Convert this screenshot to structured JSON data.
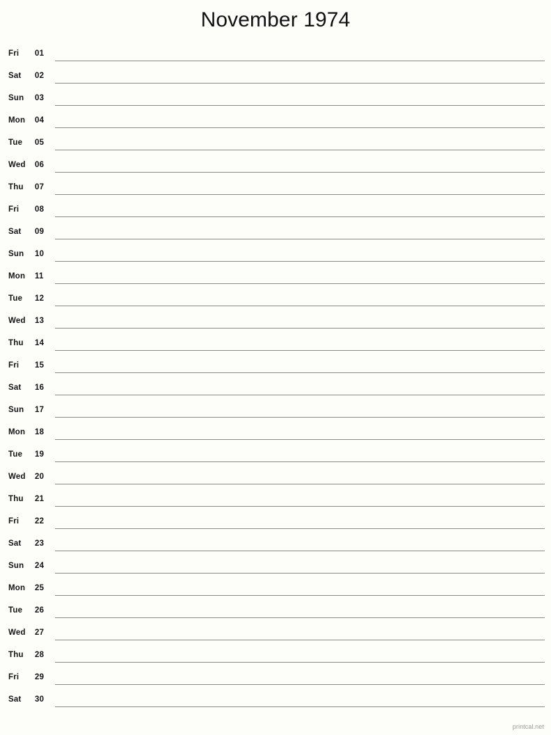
{
  "document": {
    "title": "November 1974",
    "month": "November",
    "year": "1974"
  },
  "footer": {
    "brand": "printcal.net"
  },
  "calendar": {
    "type": "single-column-notes-list",
    "days_in_month": 30,
    "first_weekday": "Fri",
    "rows": [
      {
        "weekday": "Fri",
        "date": "01"
      },
      {
        "weekday": "Sat",
        "date": "02"
      },
      {
        "weekday": "Sun",
        "date": "03"
      },
      {
        "weekday": "Mon",
        "date": "04"
      },
      {
        "weekday": "Tue",
        "date": "05"
      },
      {
        "weekday": "Wed",
        "date": "06"
      },
      {
        "weekday": "Thu",
        "date": "07"
      },
      {
        "weekday": "Fri",
        "date": "08"
      },
      {
        "weekday": "Sat",
        "date": "09"
      },
      {
        "weekday": "Sun",
        "date": "10"
      },
      {
        "weekday": "Mon",
        "date": "11"
      },
      {
        "weekday": "Tue",
        "date": "12"
      },
      {
        "weekday": "Wed",
        "date": "13"
      },
      {
        "weekday": "Thu",
        "date": "14"
      },
      {
        "weekday": "Fri",
        "date": "15"
      },
      {
        "weekday": "Sat",
        "date": "16"
      },
      {
        "weekday": "Sun",
        "date": "17"
      },
      {
        "weekday": "Mon",
        "date": "18"
      },
      {
        "weekday": "Tue",
        "date": "19"
      },
      {
        "weekday": "Wed",
        "date": "20"
      },
      {
        "weekday": "Thu",
        "date": "21"
      },
      {
        "weekday": "Fri",
        "date": "22"
      },
      {
        "weekday": "Sat",
        "date": "23"
      },
      {
        "weekday": "Sun",
        "date": "24"
      },
      {
        "weekday": "Mon",
        "date": "25"
      },
      {
        "weekday": "Tue",
        "date": "26"
      },
      {
        "weekday": "Wed",
        "date": "27"
      },
      {
        "weekday": "Thu",
        "date": "28"
      },
      {
        "weekday": "Fri",
        "date": "29"
      },
      {
        "weekday": "Sat",
        "date": "30"
      }
    ]
  },
  "colors": {
    "page_background": "#fdfdfa",
    "text": "#141414",
    "title": "#111111",
    "rule": "#8a8a88",
    "footer_text": "#9a9a98"
  }
}
